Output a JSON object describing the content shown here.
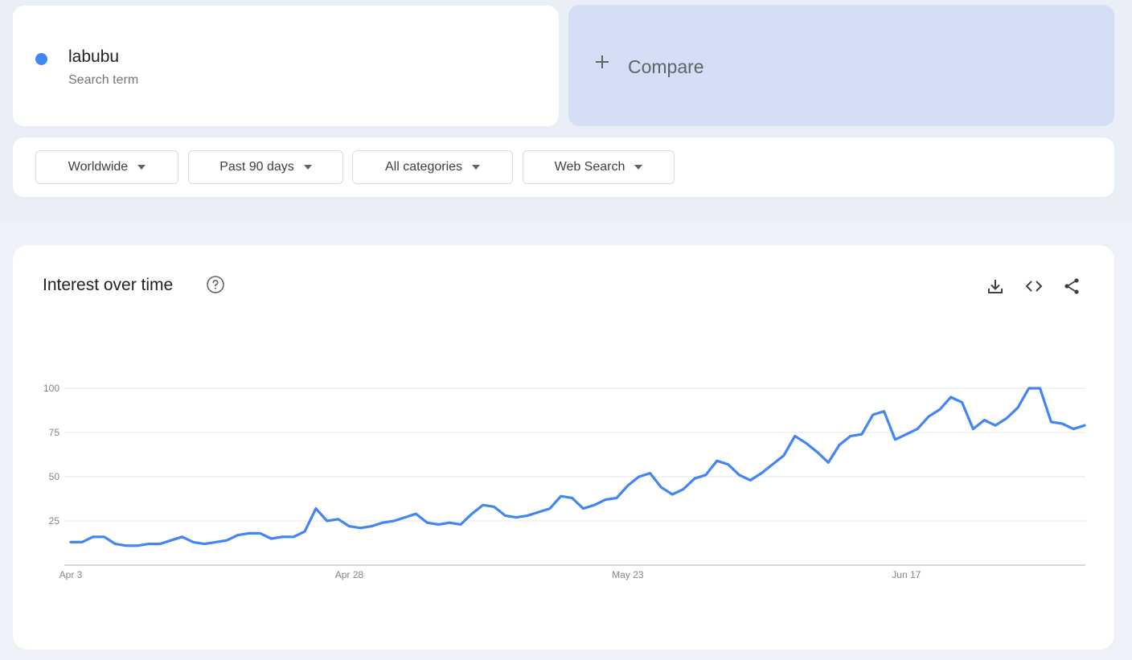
{
  "search_term": {
    "name": "labubu",
    "subtitle": "Search term",
    "color": "#4285f4"
  },
  "compare": {
    "label": "Compare",
    "icon": "plus-icon"
  },
  "filters": {
    "region": "Worldwide",
    "time_range": "Past 90 days",
    "category": "All categories",
    "search_type": "Web Search"
  },
  "chart_panel": {
    "title": "Interest over time",
    "help_icon": "help-circle-icon",
    "actions": [
      "download-icon",
      "embed-code-icon",
      "share-icon"
    ]
  },
  "chart_data": {
    "type": "line",
    "title": "Interest over time",
    "series": [
      {
        "name": "labubu",
        "color": "#4285f4",
        "values": [
          13,
          13,
          16,
          16,
          12,
          11,
          11,
          12,
          12,
          14,
          16,
          13,
          12,
          13,
          14,
          17,
          18,
          18,
          15,
          16,
          16,
          19,
          32,
          25,
          26,
          22,
          21,
          22,
          24,
          25,
          27,
          29,
          24,
          23,
          24,
          23,
          29,
          34,
          33,
          28,
          27,
          28,
          30,
          32,
          39,
          38,
          32,
          34,
          37,
          38,
          45,
          50,
          52,
          44,
          40,
          43,
          49,
          51,
          59,
          57,
          51,
          48,
          52,
          57,
          62,
          73,
          69,
          64,
          58,
          68,
          73,
          74,
          85,
          87,
          71,
          74,
          77,
          84,
          88,
          95,
          92,
          77,
          82,
          79,
          83,
          89,
          100,
          100,
          81,
          80,
          77,
          79
        ]
      }
    ],
    "x_start_label": "Apr 3",
    "x_ticks": [
      {
        "index": 0,
        "label": "Apr 3"
      },
      {
        "index": 25,
        "label": "Apr 28"
      },
      {
        "index": 50,
        "label": "May 23"
      },
      {
        "index": 75,
        "label": "Jun 17"
      }
    ],
    "y_ticks": [
      25,
      50,
      75,
      100
    ],
    "ylim": [
      0,
      100
    ],
    "grid": true
  }
}
